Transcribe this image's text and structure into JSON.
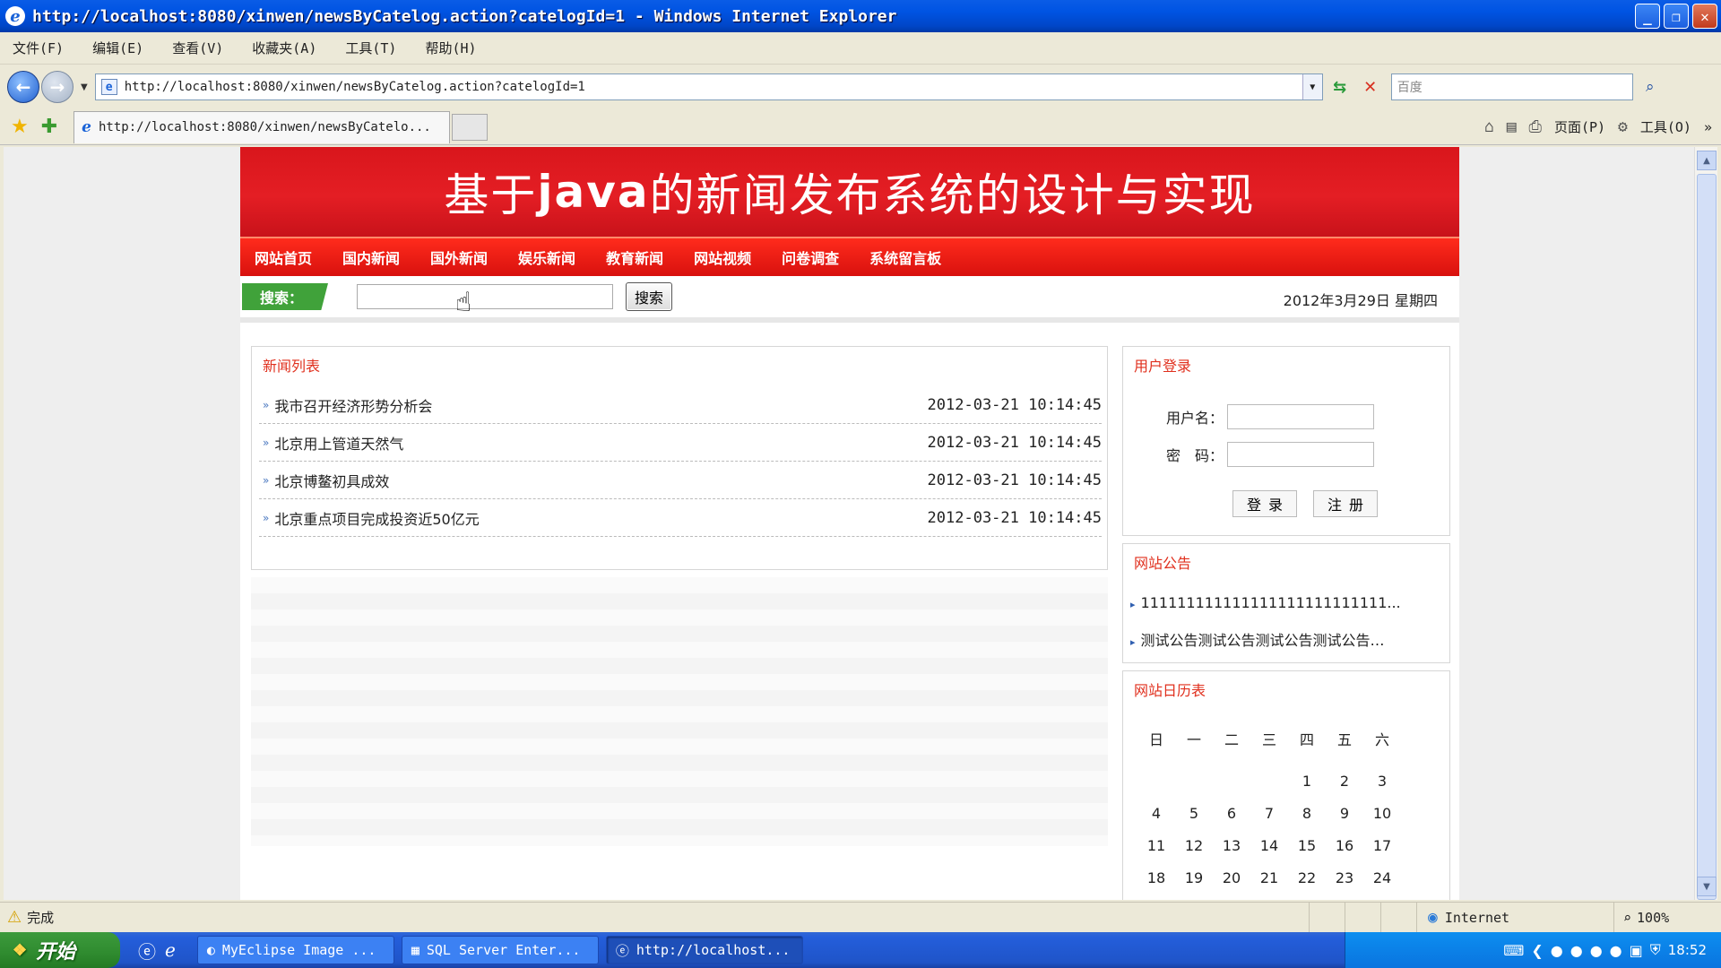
{
  "window": {
    "title": "http://localhost:8080/xinwen/newsByCatelog.action?catelogId=1 - Windows Internet Explorer",
    "minimize": "_",
    "restore": "❐",
    "close": "✕"
  },
  "menu": [
    "文件(F)",
    "编辑(E)",
    "查看(V)",
    "收藏夹(A)",
    "工具(T)",
    "帮助(H)"
  ],
  "address_bar": {
    "url": "http://localhost:8080/xinwen/newsByCatelog.action?catelogId=1",
    "search_placeholder": "百度"
  },
  "tab": {
    "label": "http://localhost:8080/xinwen/newsByCatelo..."
  },
  "right_tools": {
    "page": "页面(P)",
    "tools": "工具(O)"
  },
  "site": {
    "banner_prefix": "基于",
    "banner_bold": "java",
    "banner_suffix": "的新闻发布系统的设计与实现",
    "nav": [
      "网站首页",
      "国内新闻",
      "国外新闻",
      "娱乐新闻",
      "教育新闻",
      "网站视频",
      "问卷调查",
      "系统留言板"
    ],
    "search_label": "搜索：",
    "search_button": "搜索",
    "date": "2012年3月29日 星期四"
  },
  "news": {
    "title": "新闻列表",
    "items": [
      {
        "title": "我市召开经济形势分析会",
        "time": "2012-03-21 10:14:45"
      },
      {
        "title": "北京用上管道天然气",
        "time": "2012-03-21 10:14:45"
      },
      {
        "title": "北京博鳌初具成效",
        "time": "2012-03-21 10:14:45"
      },
      {
        "title": "北京重点项目完成投资近50亿元",
        "time": "2012-03-21 10:14:45"
      }
    ]
  },
  "login": {
    "title": "用户登录",
    "username_label": "用户名：",
    "password_label": "密　码：",
    "login_button": "登录",
    "register_button": "注册"
  },
  "notice": {
    "title": "网站公告",
    "items": [
      "111111111111111111111111111...",
      "测试公告测试公告测试公告测试公告…"
    ]
  },
  "calendar": {
    "title": "网站日历表",
    "weekdays": [
      "日",
      "一",
      "二",
      "三",
      "四",
      "五",
      "六"
    ],
    "rows": [
      [
        "",
        "",
        "",
        "",
        "1",
        "2",
        "3"
      ],
      [
        "4",
        "5",
        "6",
        "7",
        "8",
        "9",
        "10"
      ],
      [
        "11",
        "12",
        "13",
        "14",
        "15",
        "16",
        "17"
      ],
      [
        "18",
        "19",
        "20",
        "21",
        "22",
        "23",
        "24"
      ]
    ]
  },
  "status": {
    "text": "完成",
    "zone": "Internet",
    "zoom": "100%"
  },
  "taskbar": {
    "start": "开始",
    "tasks": [
      "MyEclipse Image ...",
      "SQL Server Enter...",
      "http://localhost..."
    ],
    "clock": "18:52"
  }
}
